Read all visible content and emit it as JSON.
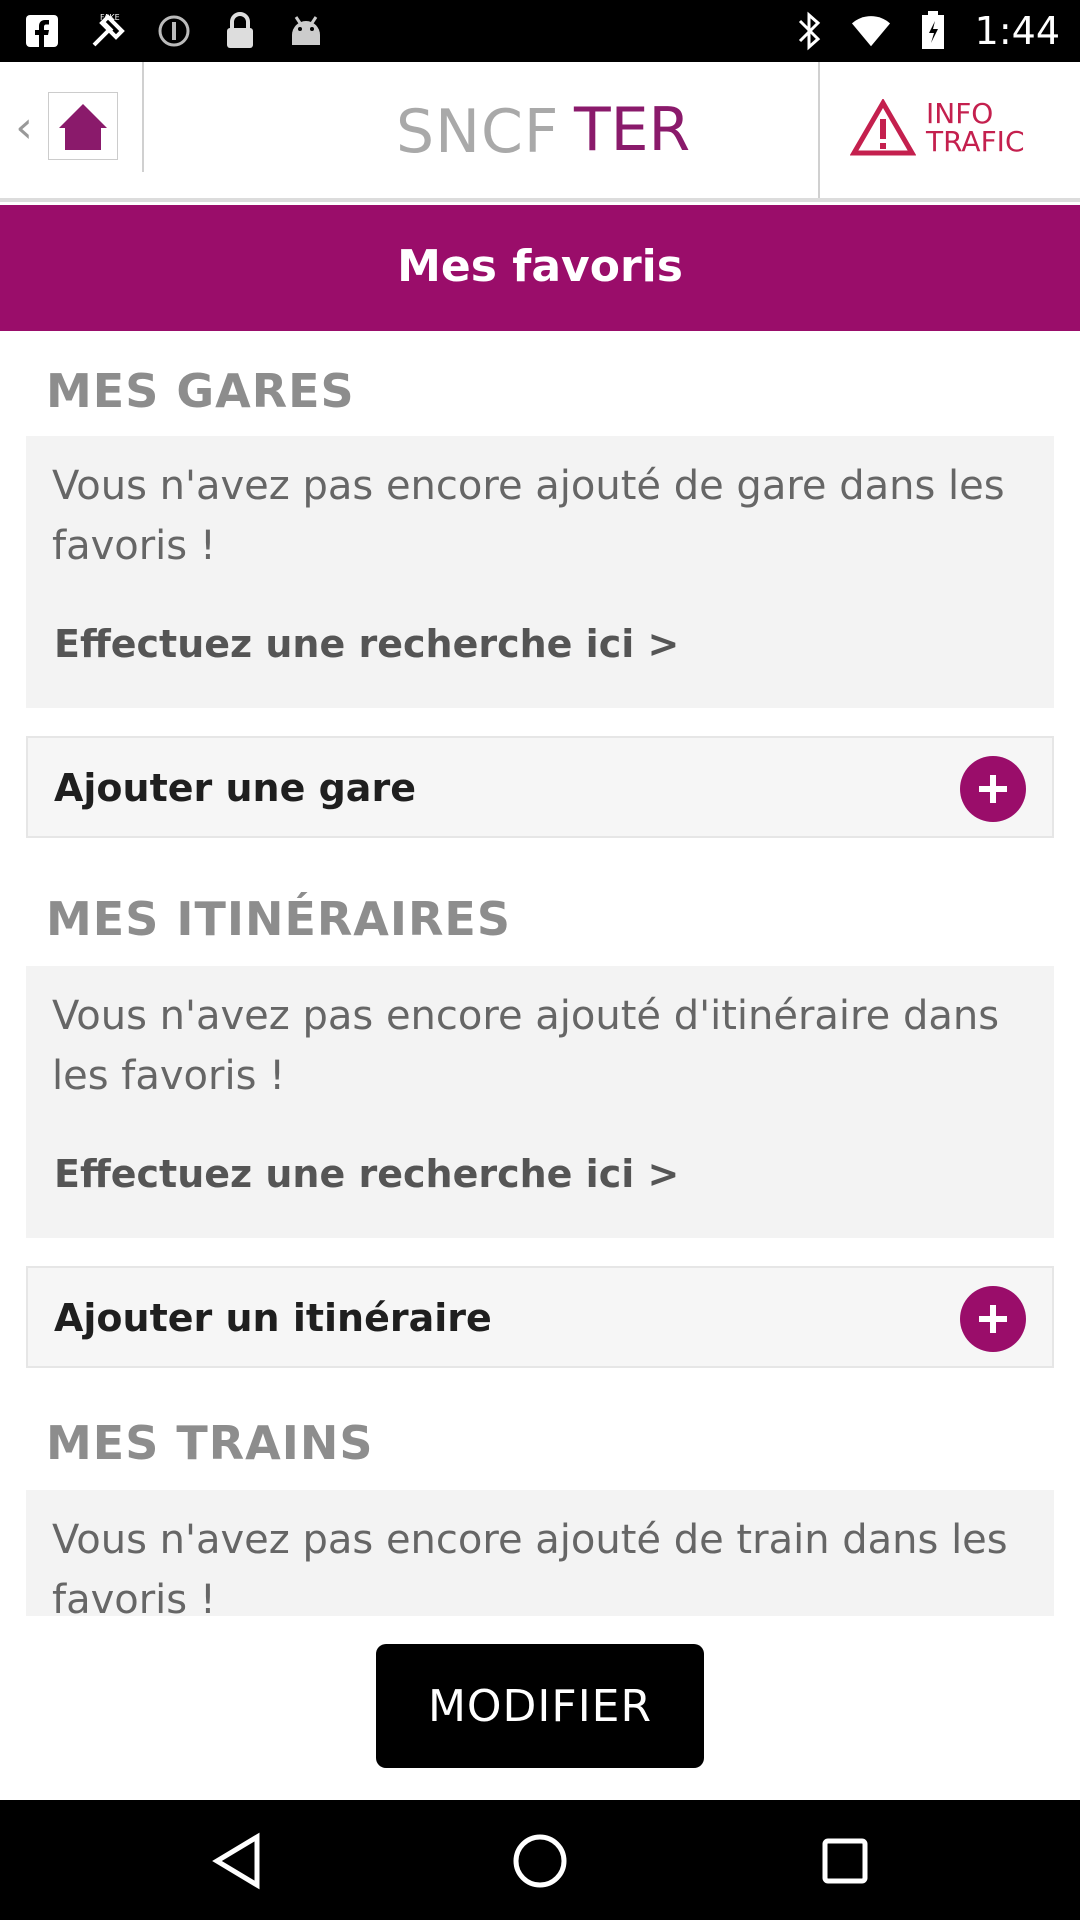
{
  "status_bar": {
    "time": "1:44",
    "left_icons": [
      "facebook-icon",
      "fake-gps-icon",
      "alert-circle-icon",
      "lock-icon",
      "android-icon"
    ],
    "right_icons": [
      "bluetooth-icon",
      "wifi-icon",
      "battery-icon"
    ]
  },
  "header": {
    "back_glyph": "‹",
    "logo_sncf": "SNCF",
    "logo_ter": "TER",
    "info_trafic_line1": "INFO",
    "info_trafic_line2": "TRAFIC"
  },
  "page": {
    "title": "Mes favoris"
  },
  "sections": {
    "gares": {
      "heading": "MES GARES",
      "empty_text": "Vous n'avez pas encore ajouté de gare dans les favoris !",
      "link": "Effectuez une recherche ici >",
      "add_label": "Ajouter une gare"
    },
    "itineraires": {
      "heading": "MES ITINÉRAIRES",
      "empty_text": "Vous n'avez pas encore ajouté d'itinéraire dans les favoris !",
      "link": "Effectuez une recherche ici >",
      "add_label": "Ajouter un itinéraire"
    },
    "trains": {
      "heading": "MES TRAINS",
      "empty_text": "Vous n'avez pas encore ajouté de train dans les favoris !"
    }
  },
  "modify_button": "MODIFIER",
  "colors": {
    "accent": "#9a0d6a",
    "heading_gray": "#8d8d8d",
    "ter_purple": "#8a1a6b",
    "info_red": "#c4204e"
  }
}
